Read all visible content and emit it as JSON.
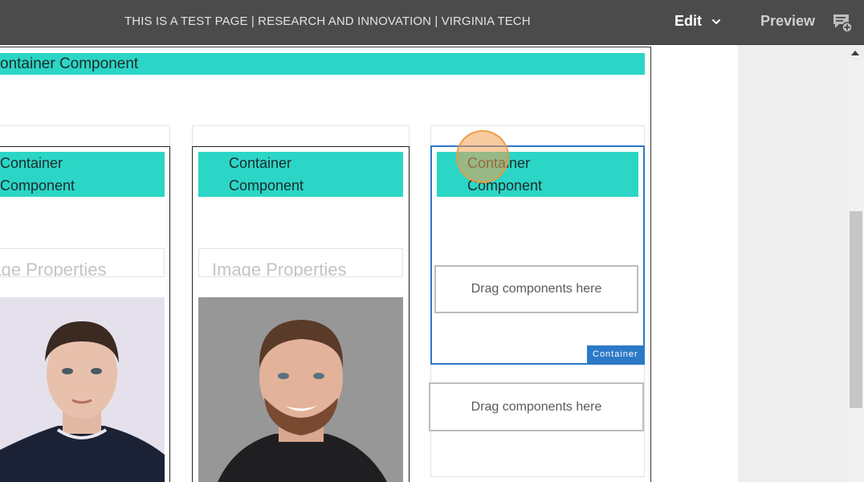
{
  "header": {
    "page_title": "THIS IS A TEST PAGE | RESEARCH AND INNOVATION | VIRGINIA TECH",
    "edit_label": "Edit",
    "preview_label": "Preview",
    "annotations_icon": "annotations-icon"
  },
  "canvas": {
    "top_banner_label": "ontainer Component",
    "columns": [
      {
        "card_line1": "Container",
        "card_line2": "Component",
        "image_properties_label": "Image Properties"
      },
      {
        "card_line1": "Container",
        "card_line2": "Component",
        "image_properties_label": "Image Properties"
      },
      {
        "card_line1": "Container",
        "card_line2": "Component",
        "drag_placeholder": "Drag components here",
        "selected_label": "Container"
      }
    ],
    "outer_drag_placeholder": "Drag components here"
  },
  "colors": {
    "teal": "#2bd6c6",
    "selection_blue": "#2c79c7",
    "topbar": "#4b4b4b"
  }
}
